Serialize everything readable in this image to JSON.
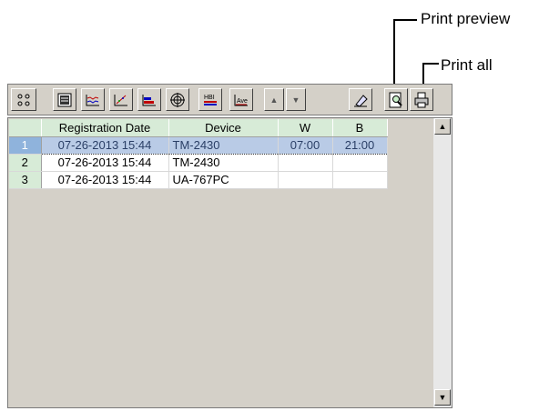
{
  "callouts": {
    "print_preview": "Print preview",
    "print_all": "Print all"
  },
  "toolbar": {
    "buttons": [
      {
        "name": "dots-icon"
      },
      {
        "name": "list-view-icon"
      },
      {
        "name": "trend-graph-icon"
      },
      {
        "name": "scatter-graph-icon"
      },
      {
        "name": "bar-graph-icon"
      },
      {
        "name": "target-icon"
      },
      {
        "name": "hbi-icon",
        "label": "HBI"
      },
      {
        "name": "average-icon",
        "label": "Ave"
      },
      {
        "name": "arrow-up-icon",
        "glyph": "▲"
      },
      {
        "name": "arrow-down-icon",
        "glyph": "▼"
      },
      {
        "name": "eraser-icon"
      },
      {
        "name": "print-preview-icon"
      },
      {
        "name": "print-all-icon"
      }
    ]
  },
  "table": {
    "columns": [
      "",
      "Registration Date",
      "Device",
      "W",
      "B"
    ],
    "rows": [
      {
        "num": "1",
        "date": "07-26-2013 15:44",
        "device": "TM-2430",
        "w": "07:00",
        "b": "21:00",
        "selected": true
      },
      {
        "num": "2",
        "date": "07-26-2013 15:44",
        "device": "TM-2430",
        "w": "",
        "b": ""
      },
      {
        "num": "3",
        "date": "07-26-2013 15:44",
        "device": "UA-767PC",
        "w": "",
        "b": ""
      }
    ]
  },
  "colors": {
    "header_bg": "#d7ebd7",
    "selected_row": "#b9cbe6",
    "chrome": "#d4d0c8"
  }
}
